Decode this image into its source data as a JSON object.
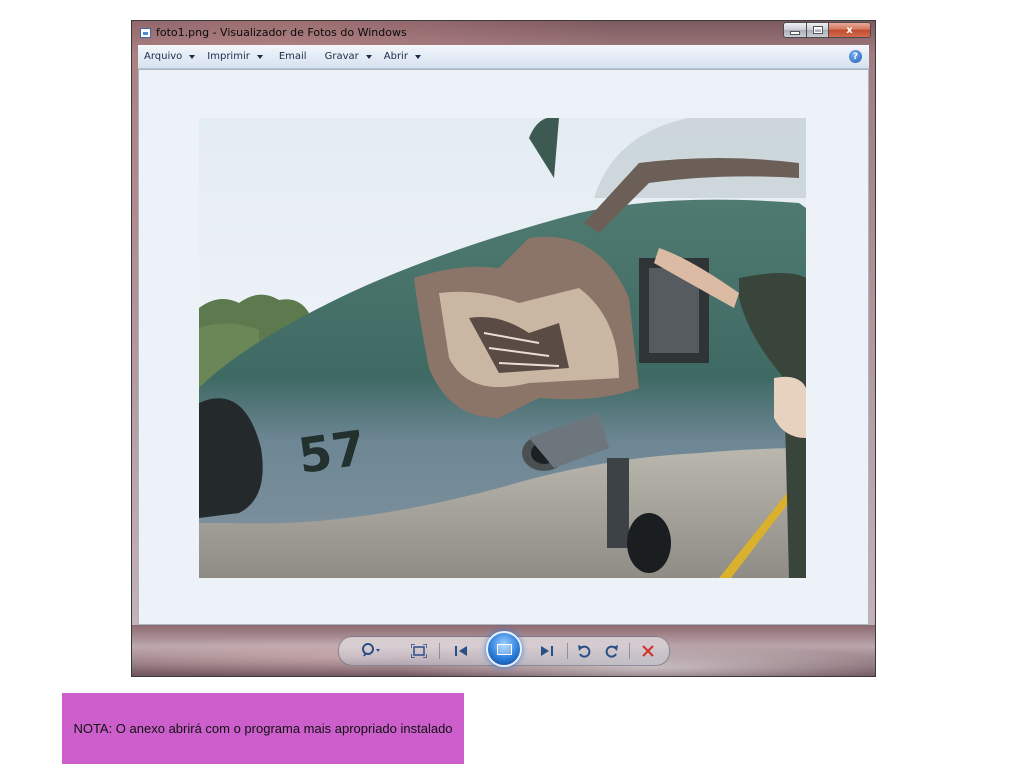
{
  "window": {
    "title": "foto1.png - Visualizador de Fotos do Windows",
    "close_label": "x"
  },
  "menubar": {
    "items": [
      {
        "label": "Arquivo",
        "has_dropdown": true
      },
      {
        "label": "Imprimir",
        "has_dropdown": true
      },
      {
        "label": "Email",
        "has_dropdown": false
      },
      {
        "label": "Gravar",
        "has_dropdown": true
      },
      {
        "label": "Abrir",
        "has_dropdown": true
      }
    ],
    "help_label": "?"
  },
  "photo": {
    "aircraft_number": "57"
  },
  "controls": {
    "icons": [
      "zoom-icon",
      "actual-size-icon",
      "previous-icon",
      "slideshow-icon",
      "next-icon",
      "rotate-counterclockwise-icon",
      "rotate-clockwise-icon",
      "delete-icon"
    ],
    "accent": "#2c7fdc",
    "delete_color": "#d0302a"
  },
  "note": {
    "text": "NOTA: O anexo abrirá com o programa mais apropriado instalado",
    "background": "#cc5fcc"
  }
}
